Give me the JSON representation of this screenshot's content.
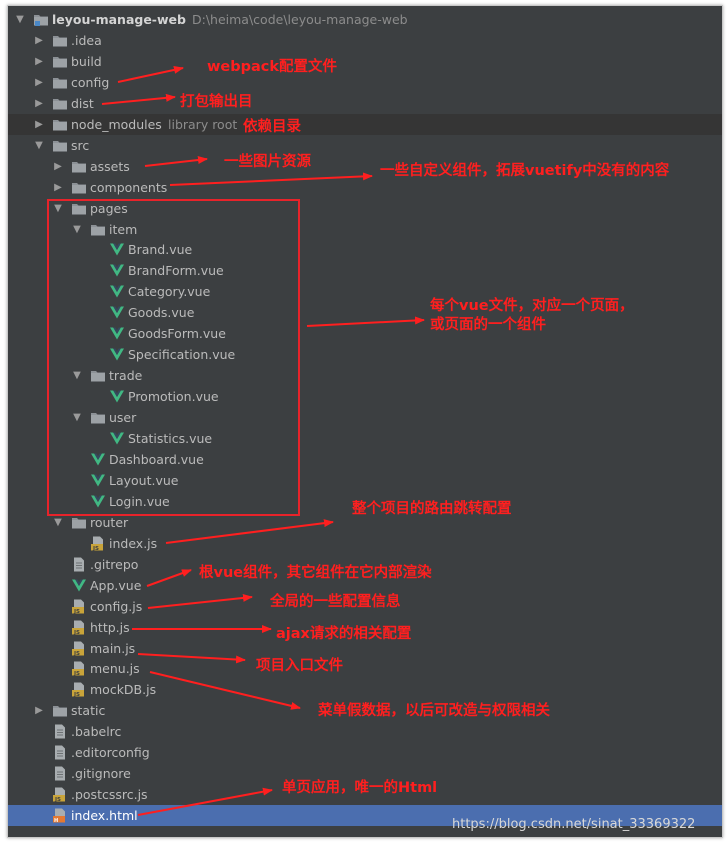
{
  "project": {
    "name": "leyou-manage-web",
    "path": "D:\\heima\\code\\leyou-manage-web"
  },
  "tree": [
    {
      "label": "leyou-manage-web",
      "hint": "D:\\heima\\code\\leyou-manage-web",
      "icon": "project-folder-icon",
      "depth": 0,
      "expanded": true,
      "bold": true
    },
    {
      "label": ".idea",
      "icon": "folder-icon",
      "depth": 1,
      "expanded": false
    },
    {
      "label": "build",
      "icon": "folder-icon",
      "depth": 1,
      "expanded": false
    },
    {
      "label": "config",
      "icon": "folder-icon",
      "depth": 1,
      "expanded": false
    },
    {
      "label": "dist",
      "icon": "folder-icon",
      "depth": 1,
      "expanded": false
    },
    {
      "label": "node_modules",
      "hint": "library root",
      "icon": "folder-icon",
      "depth": 1,
      "expanded": false,
      "highlight": true
    },
    {
      "label": "src",
      "icon": "folder-icon",
      "depth": 1,
      "expanded": true
    },
    {
      "label": "assets",
      "icon": "folder-icon",
      "depth": 2,
      "expanded": false
    },
    {
      "label": "components",
      "icon": "folder-icon",
      "depth": 2,
      "expanded": false
    },
    {
      "label": "pages",
      "icon": "folder-icon",
      "depth": 2,
      "expanded": true
    },
    {
      "label": "item",
      "icon": "folder-icon",
      "depth": 3,
      "expanded": true
    },
    {
      "label": "Brand.vue",
      "icon": "vue-file-icon",
      "depth": 4
    },
    {
      "label": "BrandForm.vue",
      "icon": "vue-file-icon",
      "depth": 4
    },
    {
      "label": "Category.vue",
      "icon": "vue-file-icon",
      "depth": 4
    },
    {
      "label": "Goods.vue",
      "icon": "vue-file-icon",
      "depth": 4
    },
    {
      "label": "GoodsForm.vue",
      "icon": "vue-file-icon",
      "depth": 4
    },
    {
      "label": "Specification.vue",
      "icon": "vue-file-icon",
      "depth": 4
    },
    {
      "label": "trade",
      "icon": "folder-icon",
      "depth": 3,
      "expanded": true
    },
    {
      "label": "Promotion.vue",
      "icon": "vue-file-icon",
      "depth": 4
    },
    {
      "label": "user",
      "icon": "folder-icon",
      "depth": 3,
      "expanded": true
    },
    {
      "label": "Statistics.vue",
      "icon": "vue-file-icon",
      "depth": 4
    },
    {
      "label": "Dashboard.vue",
      "icon": "vue-file-icon",
      "depth": 3
    },
    {
      "label": "Layout.vue",
      "icon": "vue-file-icon",
      "depth": 3
    },
    {
      "label": "Login.vue",
      "icon": "vue-file-icon",
      "depth": 3
    },
    {
      "label": "router",
      "icon": "folder-icon",
      "depth": 2,
      "expanded": true
    },
    {
      "label": "index.js",
      "icon": "js-file-icon",
      "depth": 3
    },
    {
      "label": ".gitrepo",
      "icon": "text-file-icon",
      "depth": 2
    },
    {
      "label": "App.vue",
      "icon": "vue-file-icon",
      "depth": 2
    },
    {
      "label": "config.js",
      "icon": "js-file-icon",
      "depth": 2
    },
    {
      "label": "http.js",
      "icon": "js-file-icon",
      "depth": 2
    },
    {
      "label": "main.js",
      "icon": "js-file-icon",
      "depth": 2
    },
    {
      "label": "menu.js",
      "icon": "js-file-icon",
      "depth": 2
    },
    {
      "label": "mockDB.js",
      "icon": "js-file-icon",
      "depth": 2
    },
    {
      "label": "static",
      "icon": "folder-icon",
      "depth": 1,
      "expanded": false
    },
    {
      "label": ".babelrc",
      "icon": "text-file-icon",
      "depth": 1
    },
    {
      "label": ".editorconfig",
      "icon": "text-file-icon",
      "depth": 1
    },
    {
      "label": ".gitignore",
      "icon": "text-file-icon",
      "depth": 1
    },
    {
      "label": ".postcssrc.js",
      "icon": "js-file-icon",
      "depth": 1
    },
    {
      "label": "index.html",
      "icon": "html-file-icon",
      "depth": 1,
      "selected": true
    }
  ],
  "annotations": [
    {
      "text": "webpack配置文件",
      "target": "config"
    },
    {
      "text": "打包输出目",
      "target": "dist"
    },
    {
      "text": "依赖目录",
      "target": "node_modules"
    },
    {
      "text": "一些图片资源",
      "target": "assets"
    },
    {
      "text": "一些自定义组件，拓展vuetify中没有的内容",
      "target": "components"
    },
    {
      "text": "每个vue文件，对应一个页面，",
      "target": "pages"
    },
    {
      "text": "或页面的一个组件",
      "target": "pages"
    },
    {
      "text": "整个项目的路由跳转配置",
      "target": "router/index.js"
    },
    {
      "text": "根vue组件，其它组件在它内部渲染",
      "target": "App.vue"
    },
    {
      "text": "全局的一些配置信息",
      "target": "config.js"
    },
    {
      "text": "ajax请求的相关配置",
      "target": "http.js"
    },
    {
      "text": "项目入口文件",
      "target": "main.js"
    },
    {
      "text": "菜单假数据，以后可改造与权限相关",
      "target": "menu.js"
    },
    {
      "text": "单页应用，唯一的Html",
      "target": "index.html"
    }
  ],
  "watermark": "https://blog.csdn.net/sinat_33369322",
  "colors": {
    "background": "#3c3f41",
    "selection": "#4b6eaf",
    "annotation": "#ff1f1f",
    "folder": "#8c9196",
    "vue": "#41b883",
    "js": "#c9a43a"
  }
}
